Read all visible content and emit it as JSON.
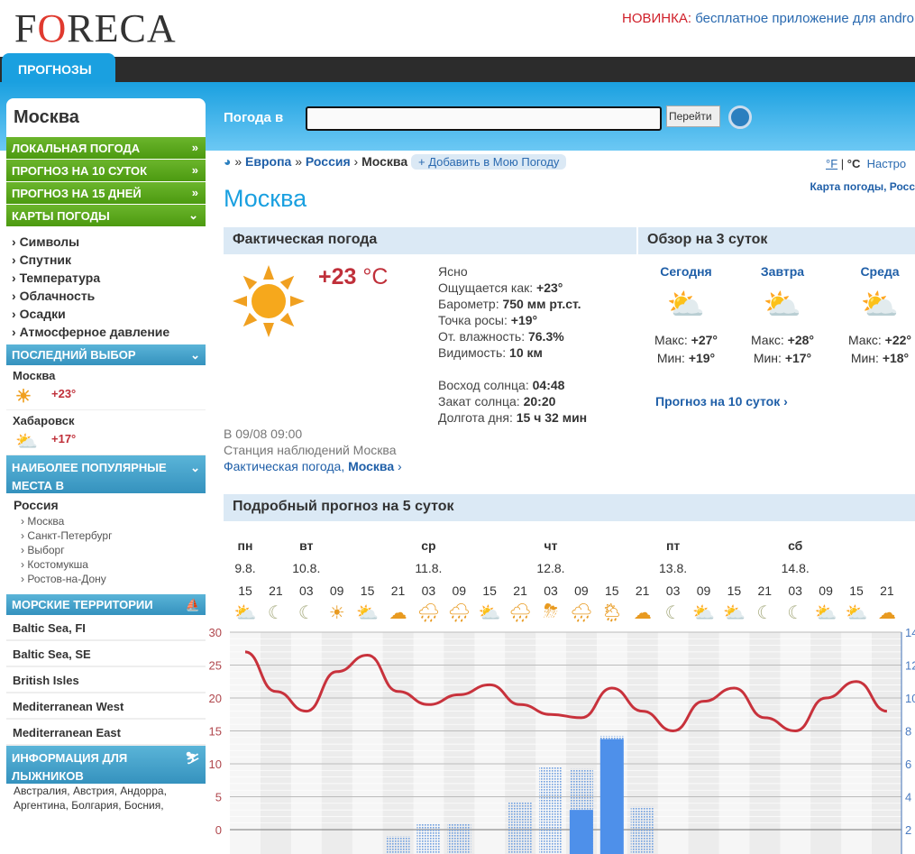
{
  "header": {
    "logo": "FORECA",
    "promo_new": "НОВИНКА:",
    "promo_text": " бесплатное приложение для andro",
    "nav_tab": "ПРОГНОЗЫ"
  },
  "search": {
    "label": "Погода в",
    "value": "",
    "go": "Перейти"
  },
  "sidebar": {
    "city": "Москва",
    "green_items": [
      {
        "label": "ЛОКАЛЬНАЯ ПОГОДА",
        "icon": "»"
      },
      {
        "label": "ПРОГНОЗ НА 10 СУТОК",
        "icon": "»"
      },
      {
        "label": "ПРОГНОЗ НА 15 ДНЕЙ",
        "icon": "»"
      },
      {
        "label": "КАРТЫ ПОГОДЫ",
        "icon": "chevron-down"
      }
    ],
    "map_links": [
      "Символы",
      "Спутник",
      "Температура",
      "Облачность",
      "Осадки",
      "Атмосферное давление"
    ],
    "recent_title": "ПОСЛЕДНИЙ ВЫБОР",
    "recent": [
      {
        "city": "Москва",
        "temp": "+23°",
        "icon": "sun"
      },
      {
        "city": "Хабаровск",
        "temp": "+17°",
        "icon": "partly-cloudy"
      }
    ],
    "popular_title": "НАИБОЛЕЕ ПОПУЛЯРНЫЕ МЕСТА В",
    "popular_country": "Россия",
    "popular": [
      "Москва",
      "Санкт-Петербург",
      "Выборг",
      "Костомукша",
      "Ростов-на-Дону"
    ],
    "sea_title": "МОРСКИЕ ТЕРРИТОРИИ",
    "seas": [
      "Baltic Sea, FI",
      "Baltic Sea, SE",
      "British Isles",
      "Mediterranean West",
      "Mediterranean East"
    ],
    "ski_title": "ИНФОРМАЦИЯ ДЛЯ ЛЫЖНИКОВ",
    "ski": [
      "Австралия, Австрия, Андорра,",
      "Аргентина, Болгария, Босния,"
    ]
  },
  "breadcrumb": {
    "items": [
      "Европа",
      "Россия"
    ],
    "current": "Москва",
    "add": "+ Добавить в Мою Погоду",
    "unit_f": "°F",
    "unit_c": "°C",
    "settings": "Настро"
  },
  "page_title": "Москва",
  "map_link": "Карта погоды, Росс",
  "current": {
    "title": "Фактическая погода",
    "temp": "+23",
    "unit": " °C",
    "condition": "Ясно",
    "rows": [
      [
        "Ощущается как:",
        "+23°"
      ],
      [
        "Барометр:",
        "750 мм рт.ст."
      ],
      [
        "Точка росы:",
        "+19°"
      ],
      [
        "От. влажность:",
        "76.3%"
      ],
      [
        "Видимость:",
        "10 км"
      ]
    ],
    "sun": [
      [
        "Восход солнца:",
        "04:48"
      ],
      [
        "Закат солнца:",
        "20:20"
      ],
      [
        "Долгота дня:",
        "15 ч 32 мин"
      ]
    ],
    "observed": "В 09/08 09:00",
    "station": "Станция наблюдений Москва",
    "link1": "Фактическая погода, ",
    "link2": "Москва"
  },
  "overview": {
    "title": "Обзор на 3 суток",
    "link": "Прогноз на 10 суток",
    "days": [
      {
        "name": "Сегодня",
        "max": "+27°",
        "min": "+19°",
        "icon": "sun-cloud"
      },
      {
        "name": "Завтра",
        "max": "+28°",
        "min": "+17°",
        "icon": "sun-cloud"
      },
      {
        "name": "Среда",
        "max": "+22°",
        "min": "+18°",
        "icon": "sun-cloud-rain"
      }
    ]
  },
  "forecast": {
    "title": "Подробный прогноз на 5 суток",
    "days": [
      {
        "name": "пн",
        "date": "9.8."
      },
      {
        "name": "вт",
        "date": "10.8."
      },
      {
        "name": "ср",
        "date": "11.8."
      },
      {
        "name": "чт",
        "date": "12.8."
      },
      {
        "name": "пт",
        "date": "13.8."
      },
      {
        "name": "сб",
        "date": "14.8."
      }
    ]
  },
  "chart_data": {
    "type": "line",
    "x": [
      "15",
      "21",
      "03",
      "09",
      "15",
      "21",
      "03",
      "09",
      "15",
      "21",
      "03",
      "09",
      "15",
      "21",
      "03",
      "09",
      "15",
      "21",
      "03",
      "09",
      "15",
      "21"
    ],
    "icons": [
      "sun-cloud",
      "moon",
      "moon",
      "sun",
      "sun-cloud",
      "cloud-moon",
      "cloud-rain",
      "rain",
      "sun-cloud",
      "cloud-rain",
      "thunder",
      "rain",
      "sun-cloud-rain",
      "cloud-moon",
      "moon",
      "sun-cloud",
      "sun-cloud",
      "moon",
      "moon",
      "sun-cloud",
      "sun-cloud",
      "cloud-moon"
    ],
    "series": [
      {
        "type": "line",
        "axis": "left",
        "values": [
          27,
          21,
          18,
          24,
          26.5,
          21,
          19,
          20.5,
          22,
          19,
          17.5,
          17,
          21.5,
          18,
          15,
          19.5,
          21.5,
          17,
          15,
          20,
          22.5,
          18
        ]
      },
      {
        "type": "bar",
        "style": "dotted",
        "axis": "right",
        "values": [
          0,
          0,
          0,
          0,
          0,
          1.6,
          2.4,
          2.4,
          0,
          3.7,
          5.8,
          5.7,
          7.7,
          3.4,
          0,
          0,
          0,
          0,
          0,
          0,
          0,
          0
        ]
      },
      {
        "type": "bar",
        "style": "solid",
        "axis": "right",
        "values": [
          0,
          0,
          0,
          0,
          0,
          0,
          0,
          0,
          0,
          0,
          0,
          3.2,
          7.5,
          0,
          0,
          0,
          0,
          0,
          0,
          0,
          0,
          0
        ]
      }
    ],
    "left_ticks": [
      30,
      25,
      20,
      15,
      10,
      5,
      0
    ],
    "right_ticks": [
      14,
      12,
      10,
      8,
      6,
      4,
      2
    ],
    "ylim_left": [
      0,
      30
    ],
    "ylim_right": [
      2,
      14
    ],
    "grid": true,
    "colors": {
      "line": "#c8323c",
      "bar": "#4e90ea",
      "left_axis": "#b0474d",
      "right_axis": "#4a7ac0"
    }
  }
}
